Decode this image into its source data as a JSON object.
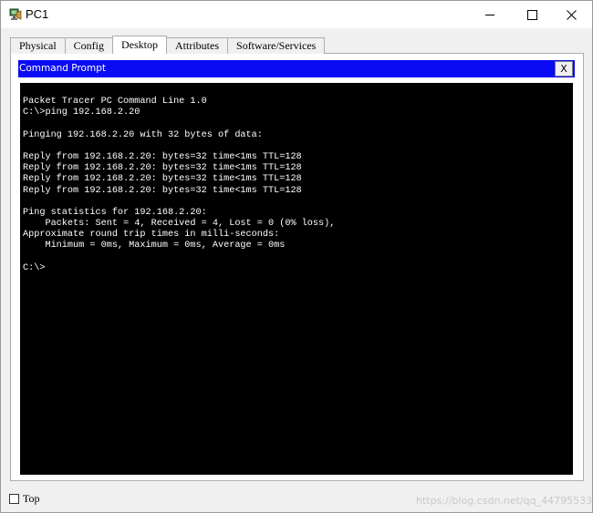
{
  "window": {
    "title": "PC1",
    "icon": "pc-device-icon",
    "controls": {
      "minimize": "—",
      "maximize": "☐",
      "close": "✕"
    }
  },
  "tabs": [
    {
      "label": "Physical",
      "active": false
    },
    {
      "label": "Config",
      "active": false
    },
    {
      "label": "Desktop",
      "active": true
    },
    {
      "label": "Attributes",
      "active": false
    },
    {
      "label": "Software/Services",
      "active": false
    }
  ],
  "command_prompt": {
    "title": "Command Prompt",
    "close_label": "X",
    "lines": [
      "Packet Tracer PC Command Line 1.0",
      "C:\\>ping 192.168.2.20",
      "",
      "Pinging 192.168.2.20 with 32 bytes of data:",
      "",
      "Reply from 192.168.2.20: bytes=32 time<1ms TTL=128",
      "Reply from 192.168.2.20: bytes=32 time<1ms TTL=128",
      "Reply from 192.168.2.20: bytes=32 time<1ms TTL=128",
      "Reply from 192.168.2.20: bytes=32 time<1ms TTL=128",
      "",
      "Ping statistics for 192.168.2.20:",
      "    Packets: Sent = 4, Received = 4, Lost = 0 (0% loss),",
      "Approximate round trip times in milli-seconds:",
      "    Minimum = 0ms, Maximum = 0ms, Average = 0ms",
      "",
      "C:\\>"
    ]
  },
  "footer": {
    "top_label": "Top",
    "top_checked": false,
    "watermark": "https://blog.csdn.net/qq_44795533"
  },
  "colors": {
    "cmd_title_bg": "#0a0af5",
    "terminal_bg": "#000000",
    "terminal_fg": "#ffffff"
  }
}
